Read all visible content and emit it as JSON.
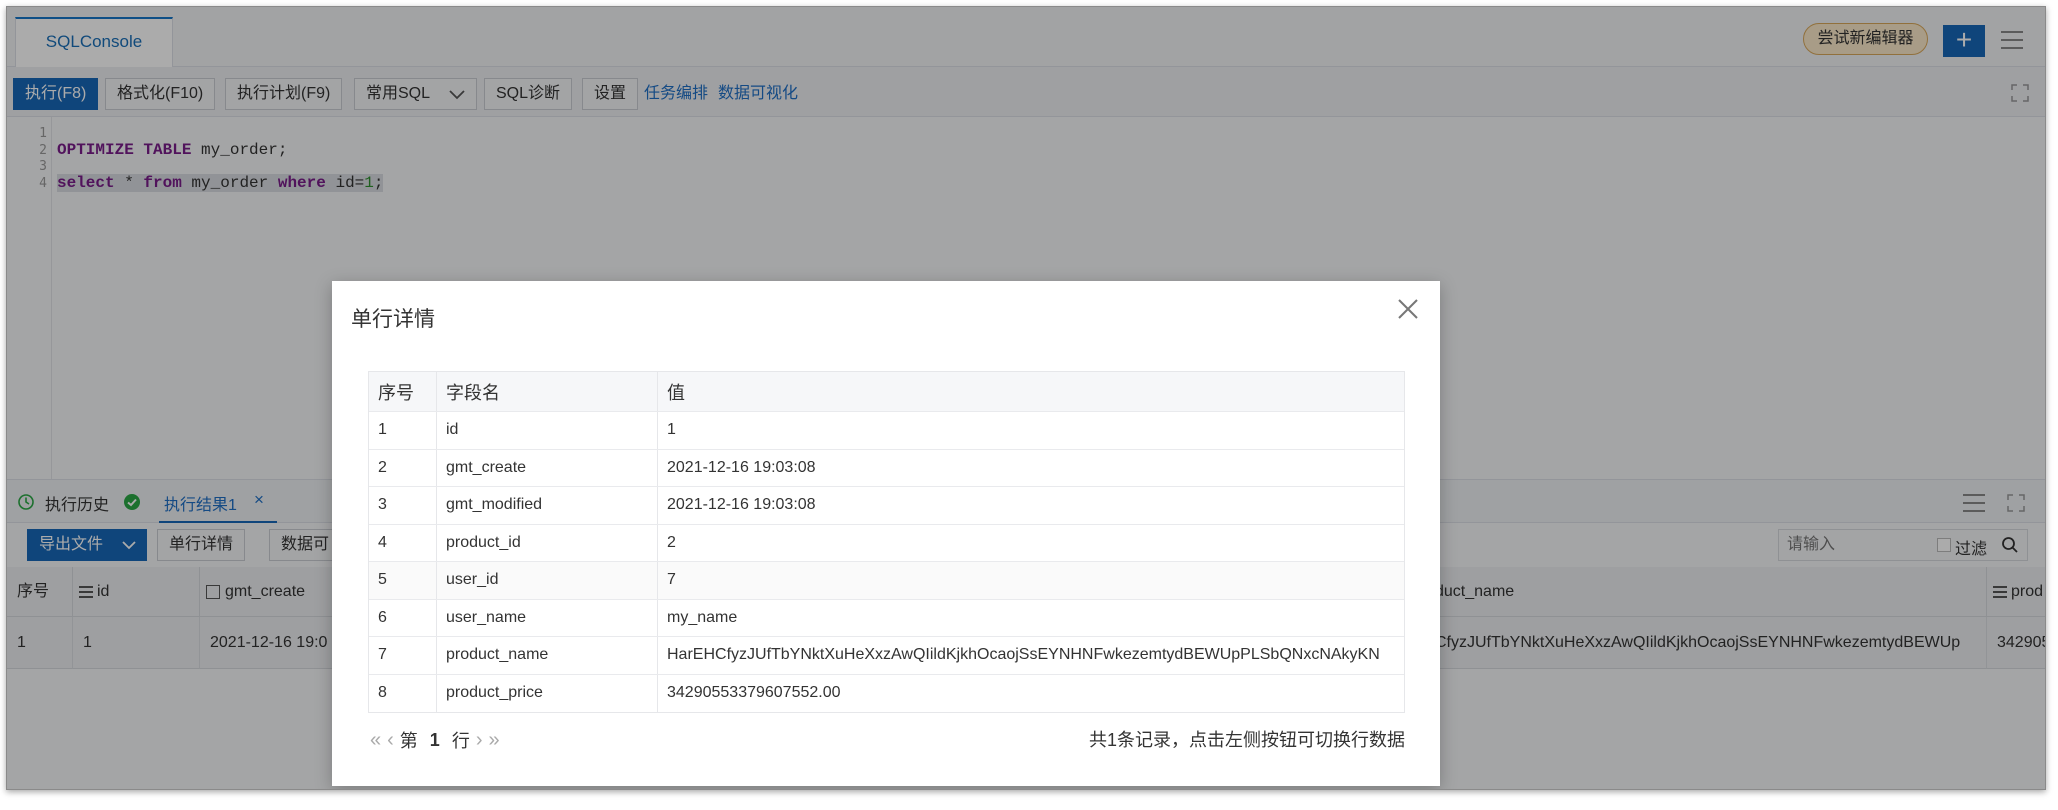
{
  "tabs": [
    {
      "label": "SQLConsole"
    }
  ],
  "header": {
    "try_new_editor": "尝试新编辑器",
    "add_label": "+"
  },
  "toolbar": {
    "run": "执行(F8)",
    "format": "格式化(F10)",
    "plan": "执行计划(F9)",
    "common_sql": "常用SQL",
    "diagnose": "SQL诊断",
    "settings": "设置",
    "task_orchestration": "任务编排",
    "data_viz": "数据可视化"
  },
  "editor": {
    "line_numbers": [
      "1",
      "2",
      "3",
      "4"
    ],
    "line2": {
      "kw1": "OPTIMIZE",
      "kw2": "TABLE",
      "rest": " my_order;"
    },
    "line4": {
      "kw1": "select",
      "mid1": " * ",
      "kw2": "from",
      "mid2": " my_order ",
      "kw3": "where",
      "mid3": " id=",
      "num": "1",
      "end": ";"
    }
  },
  "results": {
    "history_tab": "执行历史",
    "result_tab": "执行结果1",
    "close_x": "×",
    "export_button": "导出文件",
    "row_detail_button": "单行详情",
    "data_button": "数据可",
    "search_placeholder": "请输入",
    "filter_label": "过滤",
    "columns": {
      "seq": "序号",
      "id": "id",
      "gmt_create": "gmt_create",
      "product_name": "duct_name",
      "prod": "prod"
    },
    "row": {
      "seq": "1",
      "id": "1",
      "gmt_create": "2021-12-16 19:0",
      "product_name": "CfyzJUfTbYNktXuHeXxzAwQIildKjkhOcaojSsEYNHNFwkezemtydBEWUp",
      "prod": "342905"
    }
  },
  "dialog": {
    "title": "单行详情",
    "headers": {
      "seq": "序号",
      "field": "字段名",
      "value": "值"
    },
    "rows": [
      {
        "seq": "1",
        "field": "id",
        "value": "1"
      },
      {
        "seq": "2",
        "field": "gmt_create",
        "value": "2021-12-16 19:03:08"
      },
      {
        "seq": "3",
        "field": "gmt_modified",
        "value": "2021-12-16 19:03:08"
      },
      {
        "seq": "4",
        "field": "product_id",
        "value": "2"
      },
      {
        "seq": "5",
        "field": "user_id",
        "value": "7"
      },
      {
        "seq": "6",
        "field": "user_name",
        "value": "my_name"
      },
      {
        "seq": "7",
        "field": "product_name",
        "value": "HarEHCfyzJUfTbYNktXuHeXxzAwQIildKjkhOcaojSsEYNHNFwkezemtydBEWUpPLSbQNxcNAkyKN"
      },
      {
        "seq": "8",
        "field": "product_price",
        "value": "34290553379607552.00"
      }
    ],
    "pager": {
      "prefix": "第",
      "page": "1",
      "suffix": "行"
    },
    "info": "共1条记录，点击左侧按钮可切换行数据"
  },
  "colors": {
    "primary": "#1767b8",
    "link": "#1f6fc5",
    "success": "#2aa845",
    "history_icon": "#2aa845"
  }
}
